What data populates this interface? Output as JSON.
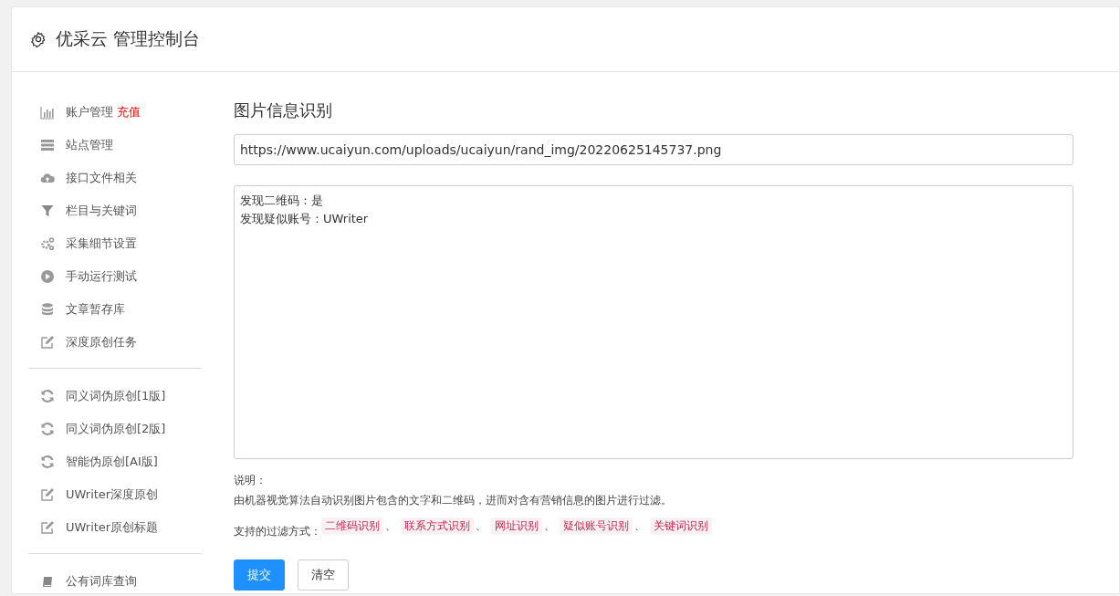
{
  "header": {
    "title": "优采云 管理控制台"
  },
  "sidebar": {
    "groups": [
      [
        {
          "label": "账户管理",
          "badge": "充值"
        },
        {
          "label": "站点管理"
        },
        {
          "label": "接口文件相关"
        },
        {
          "label": "栏目与关键词"
        },
        {
          "label": "采集细节设置"
        },
        {
          "label": "手动运行测试"
        },
        {
          "label": "文章暂存库"
        },
        {
          "label": "深度原创任务"
        }
      ],
      [
        {
          "label": "同义词伪原创[1版]"
        },
        {
          "label": "同义词伪原创[2版]"
        },
        {
          "label": "智能伪原创[AI版]"
        },
        {
          "label": "UWriter深度原创"
        },
        {
          "label": "UWriter原创标题"
        }
      ],
      [
        {
          "label": "公有词库查询"
        }
      ]
    ]
  },
  "main": {
    "heading": "图片信息识别",
    "url_field": {
      "value": "https://www.ucaiyun.com/uploads/ucaiyun/rand_img/20220625145737.png"
    },
    "result": {
      "lines": [
        "发现二维码：是",
        "发现疑似账号：UWriter"
      ]
    },
    "note_title": "说明：",
    "note_text": "由机器视觉算法自动识别图片包含的文字和二维码，进而对含有营销信息的图片进行过滤。",
    "methods_label": "支持的过滤方式：",
    "methods": [
      {
        "text": "二维码识别",
        "sep": "、"
      },
      {
        "text": "联系方式识别",
        "sep": "、"
      },
      {
        "text": "网址识别",
        "sep": "、"
      },
      {
        "text": "疑似账号识别",
        "sep": "、"
      },
      {
        "text": "关键词识别"
      }
    ],
    "buttons": [
      {
        "label": "提交",
        "kind": "primary"
      },
      {
        "label": "清空",
        "kind": "default"
      }
    ]
  }
}
